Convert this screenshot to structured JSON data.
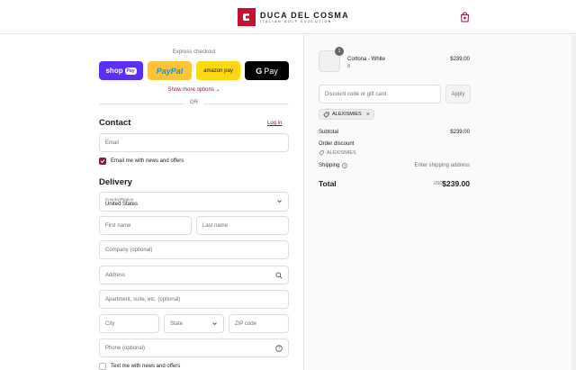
{
  "brand": {
    "name": "DUCA DEL COSMA",
    "tagline": "ITALIAN GOLF EVOLUTION",
    "accent": "#c8102e",
    "link_color": "#8a1c3a"
  },
  "express": {
    "label": "Express checkout",
    "shop_label": "shop",
    "shop_pill": "Pay",
    "paypal_a": "Pay",
    "paypal_b": "Pal",
    "amazon_label": "amazon pay",
    "gpay_g": "G",
    "gpay_label": "Pay",
    "show_more": "Show more options",
    "or": "OR"
  },
  "contact": {
    "title": "Contact",
    "login": "Log in",
    "email_placeholder": "Email",
    "news_label": "Email me with news and offers",
    "news_checked": true
  },
  "delivery": {
    "title": "Delivery",
    "country_label": "Country/Region",
    "country_value": "United States",
    "first_name": "First name",
    "last_name": "Last name",
    "company": "Company (optional)",
    "address": "Address",
    "apartment": "Apartment, suite, etc. (optional)",
    "city": "City",
    "state": "State",
    "zip": "ZIP code",
    "phone": "Phone (optional)",
    "text_label": "Text me with news and offers"
  },
  "order": {
    "item_qty": "1",
    "item_name": "Cortona - White",
    "item_variant": "8",
    "item_price": "$239.00",
    "discount_placeholder": "Discount code or gift card",
    "apply": "Apply",
    "code": "ALEXISMIES",
    "subtotal_label": "Subtotal",
    "subtotal_value": "$239.00",
    "order_discount_label": "Order discount",
    "order_discount_code": "ALEXISMIES",
    "shipping_label": "Shipping",
    "shipping_value": "Enter shipping address",
    "total_label": "Total",
    "currency": "USD",
    "total_value": "$239.00"
  }
}
